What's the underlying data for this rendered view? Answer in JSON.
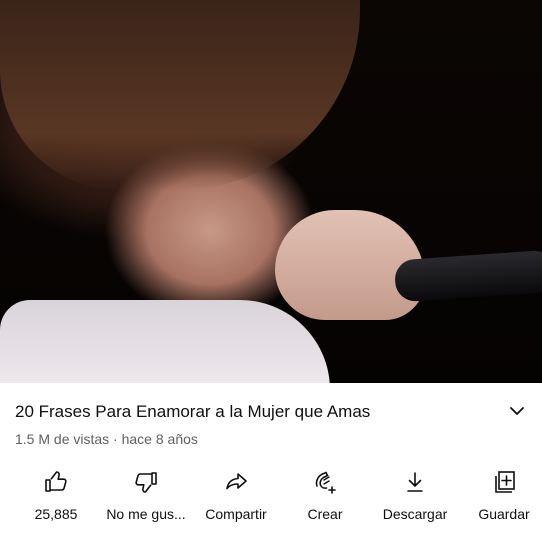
{
  "video": {
    "thumbnail_icon": "concert-singer-video-frame"
  },
  "details": {
    "title": "20 Frases Para Enamorar a la Mujer que Amas",
    "expand_icon": "chevron-down-icon",
    "views": "1.5 M de vistas",
    "separator": "·",
    "age": "hace 8 años"
  },
  "actions": [
    {
      "icon": "thumbs-up-icon",
      "label": "25,885"
    },
    {
      "icon": "thumbs-down-icon",
      "label": "No me gus..."
    },
    {
      "icon": "share-icon",
      "label": "Compartir"
    },
    {
      "icon": "create-icon",
      "label": "Crear"
    },
    {
      "icon": "download-icon",
      "label": "Descargar"
    },
    {
      "icon": "add-to-playlist-icon",
      "label": "Guardar"
    }
  ]
}
